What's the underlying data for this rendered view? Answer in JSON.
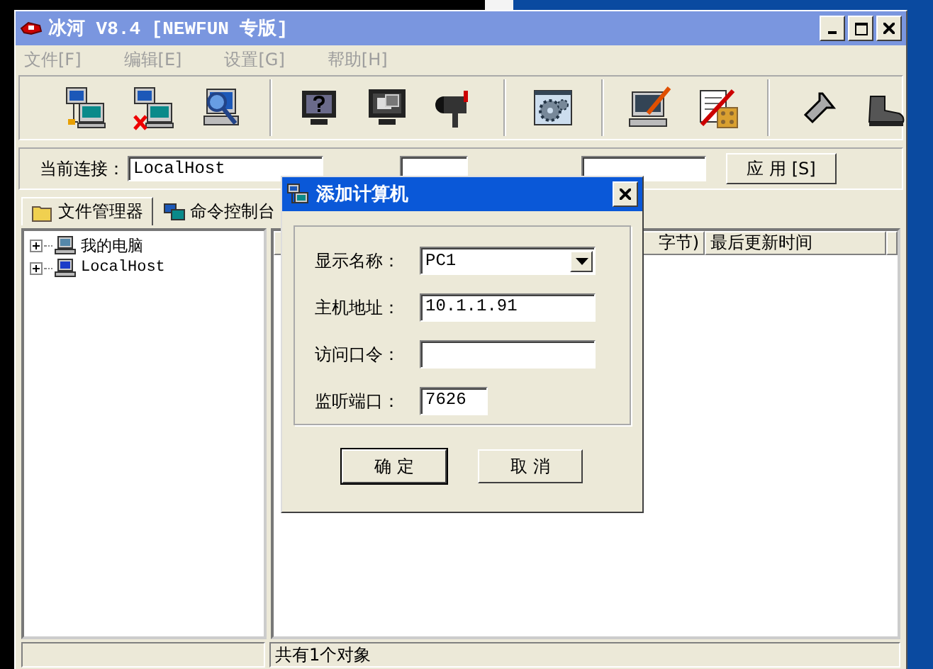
{
  "window": {
    "title": "冰河 V8.4 [NEWFUN 专版]"
  },
  "menu": [
    {
      "label": "文件[F]"
    },
    {
      "label": "编辑[E]"
    },
    {
      "label": "设置[G]"
    },
    {
      "label": "帮助[H]"
    }
  ],
  "connection": {
    "label": "当前连接：",
    "value": "LocalHost",
    "apply_button": "应 用 [S]"
  },
  "tabs": [
    {
      "label": "文件管理器",
      "selected": true
    },
    {
      "label": "命令控制台",
      "selected": false
    }
  ],
  "tree": [
    {
      "label": "我的电脑",
      "expanded": false
    },
    {
      "label": "LocalHost",
      "expanded": false
    }
  ],
  "list": {
    "columns": [
      "字节)",
      "最后更新时间"
    ]
  },
  "status_bar": {
    "text": "共有1个对象"
  },
  "dialog": {
    "title": "添加计算机",
    "fields": [
      {
        "label": "显示名称：",
        "value": "PC1",
        "kind": "combo"
      },
      {
        "label": "主机地址：",
        "value": "10.1.1.91",
        "kind": "text"
      },
      {
        "label": "访问口令：",
        "kind": "text"
      },
      {
        "label": "监听端口：",
        "value": "7626",
        "kind": "short"
      }
    ],
    "buttons": [
      {
        "label": "确 定",
        "default": true
      },
      {
        "label": "取 消",
        "default": false
      }
    ]
  }
}
